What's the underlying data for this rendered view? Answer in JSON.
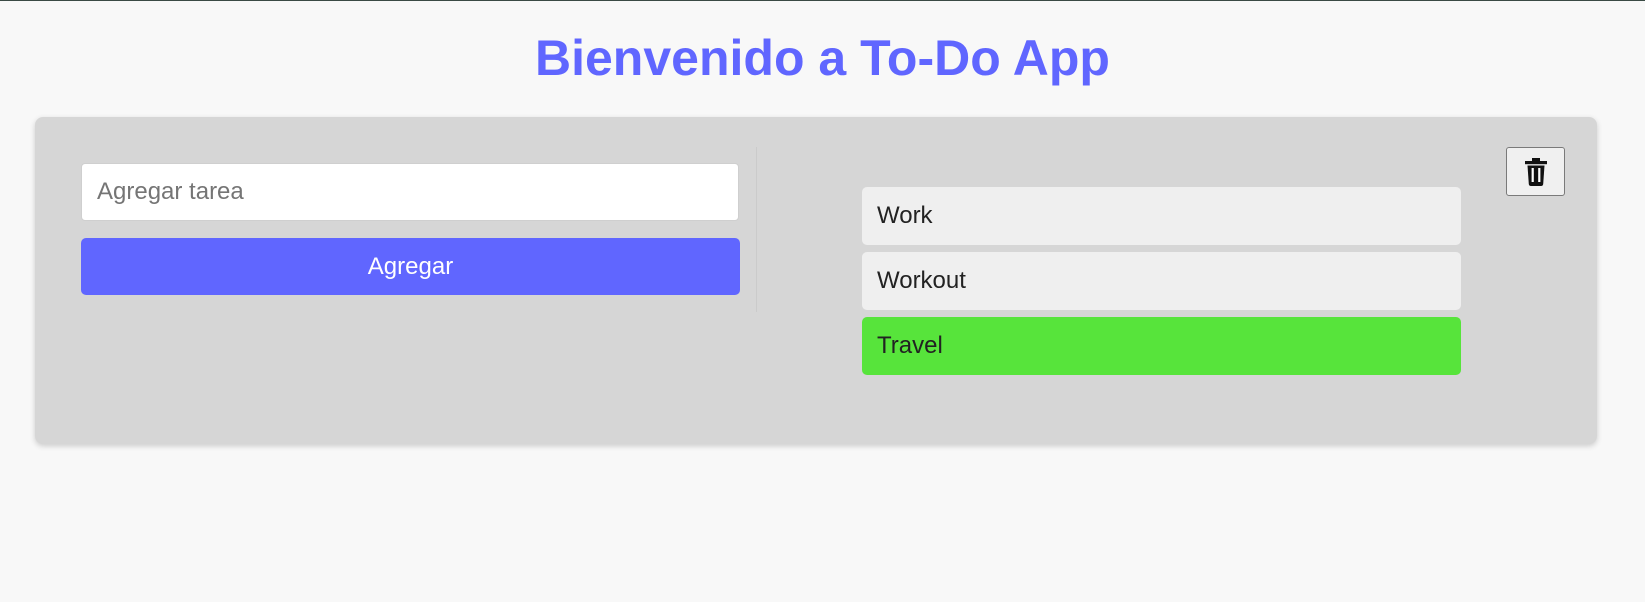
{
  "header": {
    "title": "Bienvenido a To-Do App"
  },
  "form": {
    "input_placeholder": "Agregar tarea",
    "input_value": "",
    "add_label": "Agregar"
  },
  "toolbar": {
    "delete_icon": "trash-icon"
  },
  "tasks": [
    {
      "label": "Work",
      "completed": false
    },
    {
      "label": "Workout",
      "completed": false
    },
    {
      "label": "Travel",
      "completed": true
    }
  ],
  "colors": {
    "accent": "#6066ff",
    "completed": "#57e43b",
    "panel": "#d6d6d6",
    "task": "#efefef",
    "page": "#f8f8f8"
  }
}
